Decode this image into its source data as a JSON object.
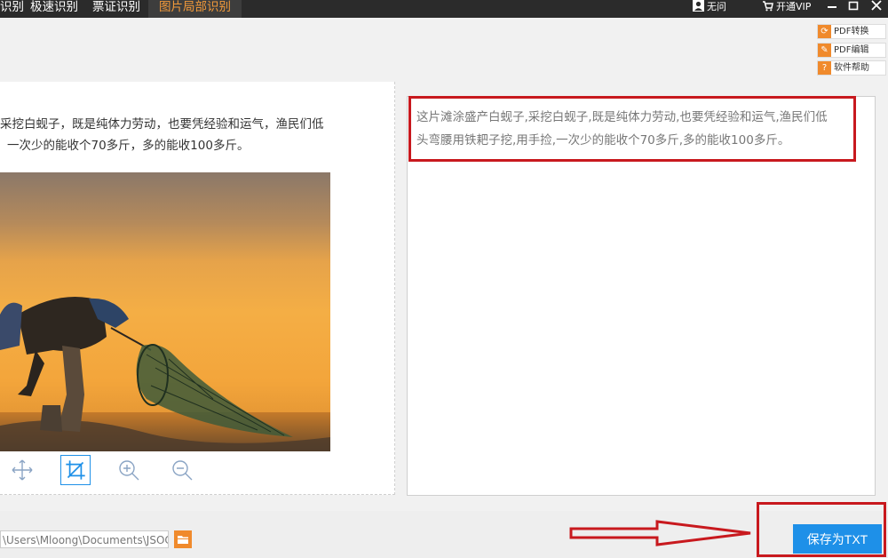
{
  "topbar": {
    "tabs": [
      {
        "label": "识别"
      },
      {
        "label": "极速识别"
      },
      {
        "label": "票证识别"
      },
      {
        "label": "图片局部识别",
        "active": true
      }
    ],
    "user_name": "无问",
    "vip_label": "开通VIP",
    "active_color": "#f39a3a"
  },
  "side_tools": [
    {
      "label": "PDF转换",
      "icon": "refresh-icon"
    },
    {
      "label": "PDF编辑",
      "icon": "pencil-icon"
    },
    {
      "label": "软件帮助",
      "icon": "help-icon"
    }
  ],
  "source": {
    "text_lines": [
      "采挖白蚬子，既是纯体力劳动，也要凭经验和运气，渔民们低",
      "一次少的能收个70多斤，多的能收100多斤。"
    ],
    "tools": [
      "move-icon",
      "crop-icon",
      "zoom-in-icon",
      "zoom-out-icon"
    ]
  },
  "result": {
    "lines": [
      "这片滩涂盛产白蚬子,采挖白蚬子,既是纯体力劳动,也要凭经验和运气,渔民们低",
      "头弯腰用铁耙子挖,用手捡,一次少的能收个70多斤,多的能收100多斤。"
    ]
  },
  "bottom": {
    "save_path": "\\Users\\Mloong\\Documents\\JSOC",
    "save_button": "保存为TXT",
    "accent": "#1e90e8",
    "highlight": "#c8191e"
  }
}
